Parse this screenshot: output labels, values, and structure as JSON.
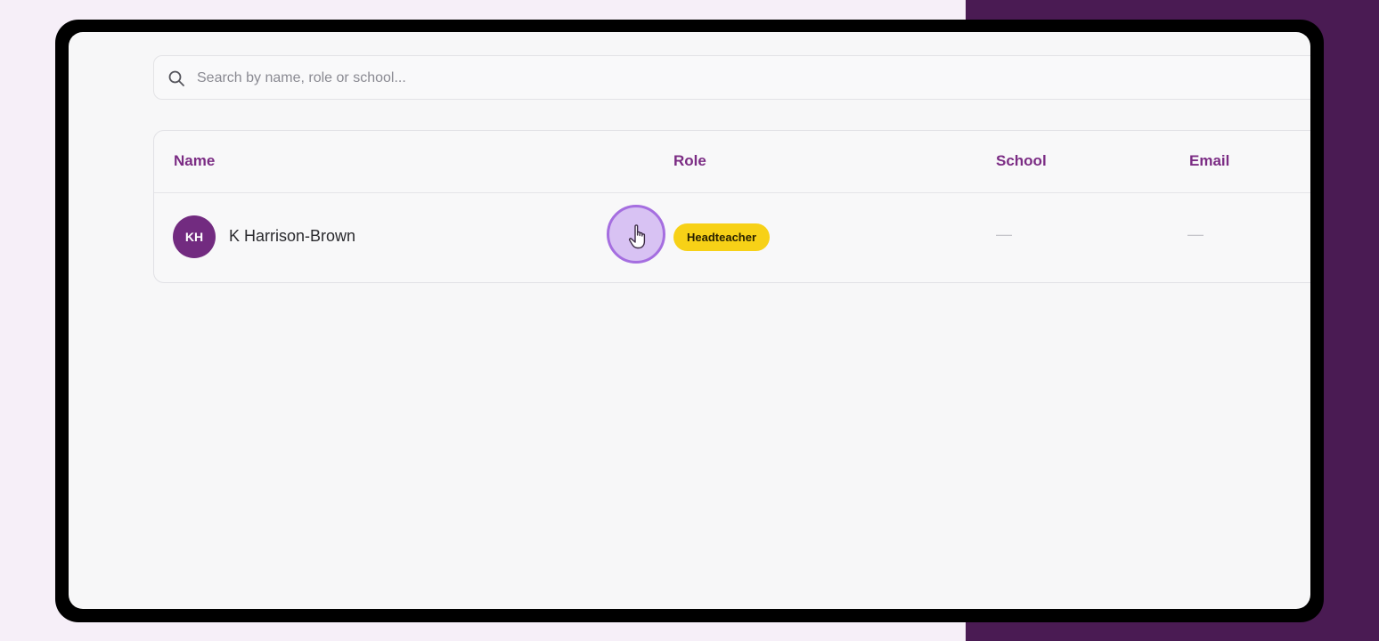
{
  "search": {
    "placeholder": "Search by name, role or school...",
    "value": ""
  },
  "table": {
    "columns": [
      "Name",
      "Role",
      "School",
      "Email"
    ],
    "rows": [
      {
        "initials": "KH",
        "name": "K Harrison-Brown",
        "role": "Headteacher",
        "school": "—",
        "email": "—"
      }
    ]
  },
  "colors": {
    "accent_purple": "#722b80",
    "header_text": "#7b2c84",
    "badge_yellow": "#f7d117",
    "backdrop_dark": "#4a1b53",
    "cursor_highlight": "#cfb0f0"
  },
  "icons": {
    "search": "search-icon",
    "cursor": "hand-pointer-icon"
  }
}
